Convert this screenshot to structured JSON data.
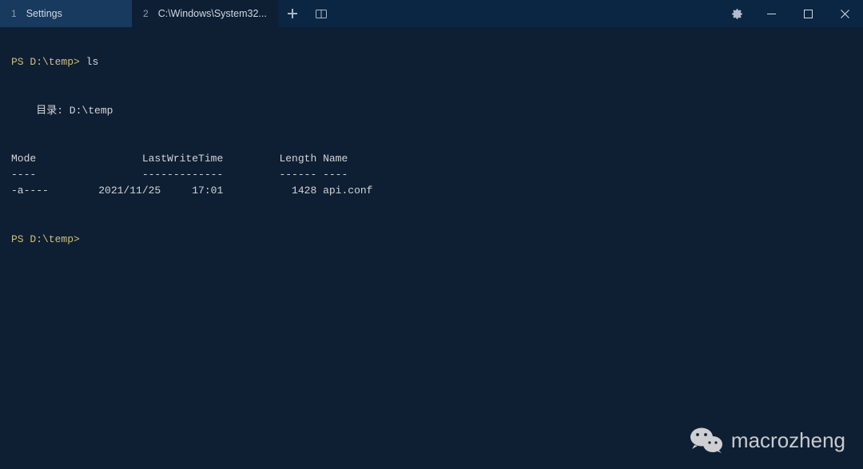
{
  "titlebar": {
    "tabs": [
      {
        "num": "1",
        "label": "Settings"
      },
      {
        "num": "2",
        "label": "C:\\Windows\\System32..."
      }
    ],
    "newtab_icon": "plus-icon",
    "split_icon": "split-icon",
    "settings_icon": "gear-icon",
    "minimize_icon": "minimize-icon",
    "maximize_icon": "maximize-icon",
    "close_icon": "close-icon"
  },
  "terminal": {
    "prompt1": "PS D:\\temp>",
    "cmd1": "ls",
    "blank1": " ",
    "blank2": " ",
    "out1": "    目录: D:\\temp",
    "blank3": " ",
    "blank4": " ",
    "header": "Mode                 LastWriteTime         Length Name",
    "divider": "----                 -------------         ------ ----",
    "row1": "-a----        2021/11/25     17:01           1428 api.conf",
    "blank5": " ",
    "blank6": " ",
    "prompt2": "PS D:\\temp>",
    "cursor": " "
  },
  "watermark": {
    "text": "macrozheng"
  }
}
